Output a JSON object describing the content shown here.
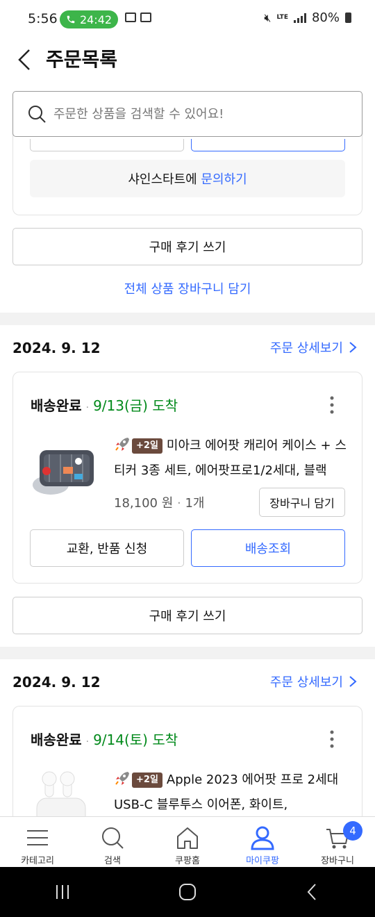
{
  "status_bar": {
    "time": "5:56",
    "call_timer": "24:42",
    "battery": "80%",
    "network": "LTE"
  },
  "header": {
    "title": "주문목록"
  },
  "search": {
    "placeholder": "주문한 상품을 검색할 수 있어요!"
  },
  "previous_order": {
    "seller_prefix": "샤인스타트에 ",
    "inquiry_link": "문의하기",
    "review_button": "구매 후기 쓰기",
    "cart_all_link": "전체 상품 장바구니 담기"
  },
  "orders": [
    {
      "date": "2024. 9. 12",
      "detail_link": "주문 상세보기",
      "status": "배송완료",
      "separator": "·",
      "arrival": "9/13(금) 도착",
      "badge": "+2일",
      "product_name": "미아크 에어팟 캐리어 케이스 + 스티커 3종 세트, 에어팟프로1/2세대, 블랙",
      "price": "18,100 원",
      "quantity": "1개",
      "add_to_cart": "장바구니 담기",
      "exchange_button": "교환, 반품 신청",
      "tracking_button": "배송조회",
      "review_button": "구매 후기 쓰기"
    },
    {
      "date": "2024. 9. 12",
      "detail_link": "주문 상세보기",
      "status": "배송완료",
      "separator": "·",
      "arrival": "9/14(토) 도착",
      "badge": "+2일",
      "product_name": "Apple 2023 에어팟 프로 2세대 USB-C 블루투스 이어폰, 화이트,"
    }
  ],
  "bottom_nav": {
    "items": [
      {
        "label": "카테고리",
        "icon": "menu-icon"
      },
      {
        "label": "검색",
        "icon": "search-icon"
      },
      {
        "label": "쿠팡홈",
        "icon": "home-icon"
      },
      {
        "label": "마이쿠팡",
        "icon": "user-icon"
      },
      {
        "label": "장바구니",
        "icon": "cart-icon"
      }
    ],
    "cart_count": "4",
    "active": "마이쿠팡"
  },
  "colors": {
    "accent_blue": "#346aff",
    "arrival_green": "#00891a",
    "badge_brown": "#6b4a3d",
    "call_green": "#3db54a"
  }
}
